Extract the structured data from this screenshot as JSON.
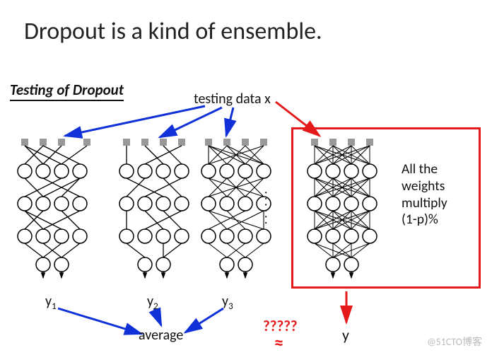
{
  "title": "Dropout is a kind of ensemble.",
  "subtitle": "Testing of Dropout",
  "testing_label": "testing data x",
  "side_text_line1": "All the",
  "side_text_line2": "weights",
  "side_text_line3": "multiply",
  "side_text_line4": "(1-p)%",
  "outputs": {
    "y1": "y",
    "sub1": "1",
    "y2": "y",
    "sub2": "2",
    "y3": "y",
    "sub3": "3"
  },
  "average": "average",
  "question": "?????",
  "approx": "≈",
  "y_final": "y",
  "ellipsis": "......",
  "watermark": "@51CTO博客",
  "diagram": {
    "type": "neural-network-ensemble",
    "n_subnets": 3,
    "layers_per_net": 4,
    "nodes_per_layer": 4,
    "outputs_per_net": 2,
    "full_net_note": "weights × (1-p)%",
    "relation": "average(y1,y2,y3,...) ≈ y"
  }
}
